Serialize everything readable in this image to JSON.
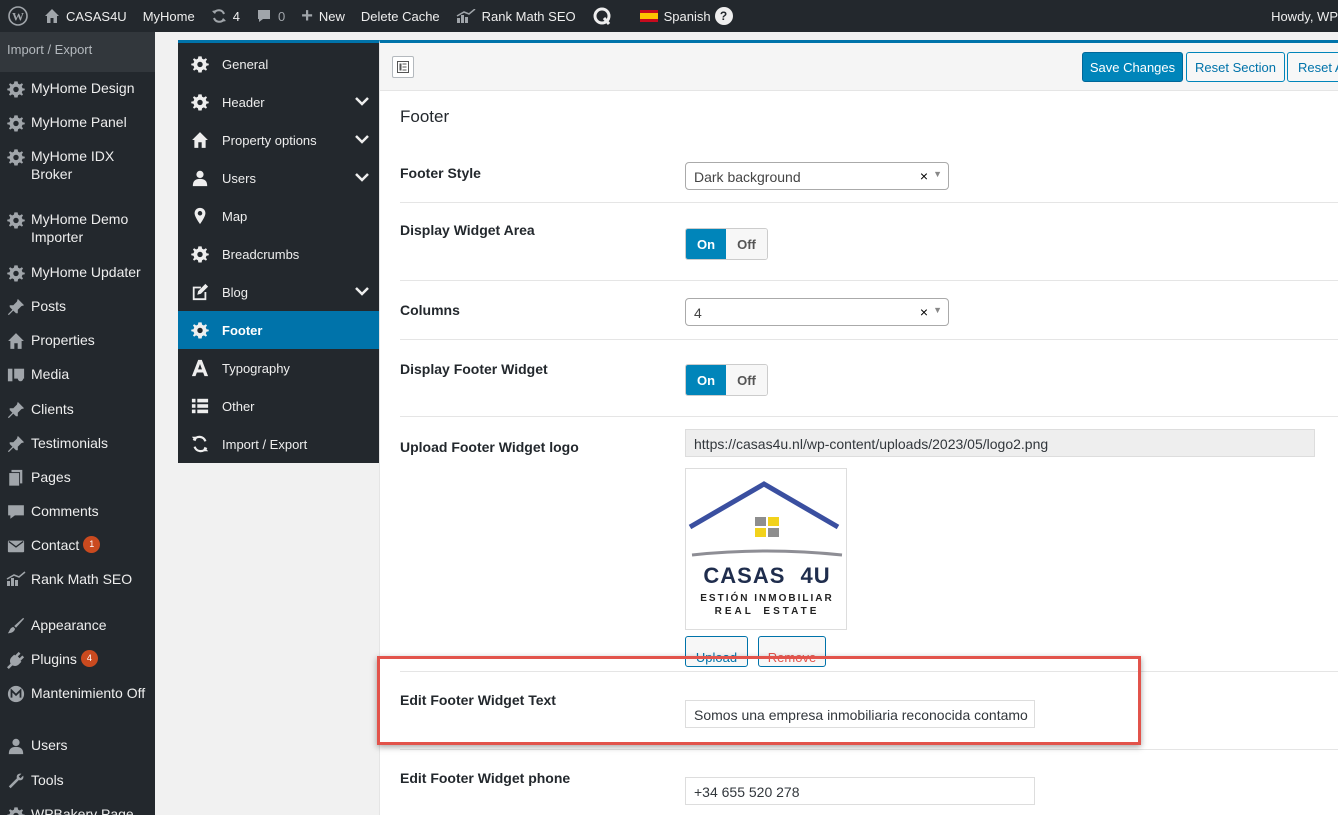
{
  "admin_bar": {
    "site_name": "CASAS4U",
    "myhome": "MyHome",
    "updates_count": "4",
    "comments_count": "0",
    "new_label": "New",
    "delete_cache": "Delete Cache",
    "rank_math": "Rank Math SEO",
    "language": "Spanish",
    "howdy": "Howdy, WP"
  },
  "admin_menu": {
    "current_submenu": "Import / Export",
    "items": [
      {
        "label": "MyHome Design",
        "icon": "gear-icon"
      },
      {
        "label": "MyHome Panel",
        "icon": "gear-icon"
      },
      {
        "label": "MyHome IDX Broker",
        "icon": "gear-icon"
      },
      {
        "label": "MyHome Demo Importer",
        "icon": "gear-icon"
      },
      {
        "label": "MyHome Updater",
        "icon": "gear-icon"
      },
      {
        "label": "Posts",
        "icon": "pin-icon"
      },
      {
        "label": "Properties",
        "icon": "home-icon"
      },
      {
        "label": "Media",
        "icon": "media-icon"
      },
      {
        "label": "Clients",
        "icon": "pin-icon"
      },
      {
        "label": "Testimonials",
        "icon": "pin-icon"
      },
      {
        "label": "Pages",
        "icon": "page-icon"
      },
      {
        "label": "Comments",
        "icon": "comment-icon"
      },
      {
        "label": "Contact",
        "icon": "mail-icon",
        "badge": "1"
      },
      {
        "label": "Rank Math SEO",
        "icon": "chart-icon"
      },
      {
        "label": "Appearance",
        "icon": "brush-icon"
      },
      {
        "label": "Plugins",
        "icon": "plug-icon",
        "badge": "4"
      },
      {
        "label": "Mantenimiento Off",
        "icon": "m-logo-icon"
      },
      {
        "label": "Users",
        "icon": "user-icon"
      },
      {
        "label": "Tools",
        "icon": "wrench-icon"
      },
      {
        "label": "WPBakery Page",
        "icon": "gear-icon"
      }
    ]
  },
  "options_nav": {
    "items": [
      {
        "label": "General",
        "icon": "gear-icon"
      },
      {
        "label": "Header",
        "icon": "gear-icon",
        "expandable": true
      },
      {
        "label": "Property options",
        "icon": "home-icon",
        "expandable": true
      },
      {
        "label": "Users",
        "icon": "user-icon",
        "expandable": true
      },
      {
        "label": "Map",
        "icon": "location-pin-icon"
      },
      {
        "label": "Breadcrumbs",
        "icon": "gear-icon"
      },
      {
        "label": "Blog",
        "icon": "edit-icon",
        "expandable": true
      },
      {
        "label": "Footer",
        "icon": "gear-icon",
        "active": true
      },
      {
        "label": "Typography",
        "icon": "typography-icon"
      },
      {
        "label": "Other",
        "icon": "list-icon"
      },
      {
        "label": "Import / Export",
        "icon": "refresh-icon"
      }
    ]
  },
  "toolbar": {
    "save_changes": "Save Changes",
    "reset_section": "Reset Section",
    "reset_all": "Reset A"
  },
  "section": {
    "title": "Footer",
    "fields": {
      "footer_style": {
        "label": "Footer Style",
        "value": "Dark background"
      },
      "display_widget_area": {
        "label": "Display Widget Area",
        "on": "On",
        "off": "Off",
        "state": "on"
      },
      "columns": {
        "label": "Columns",
        "value": "4"
      },
      "display_footer_widget": {
        "label": "Display Footer Widget",
        "on": "On",
        "off": "Off",
        "state": "on"
      },
      "upload_logo": {
        "label": "Upload Footer Widget logo",
        "url": "https://casas4u.nl/wp-content/uploads/2023/05/logo2.png",
        "upload_button": "Upload",
        "remove_button": "Remove",
        "logo_text_main": "CASAS 4U",
        "logo_text_line1": "ESTIÓN INMOBILIAR",
        "logo_text_line2": "REAL ESTATE"
      },
      "widget_text": {
        "label": "Edit Footer Widget Text",
        "value": "Somos una empresa inmobiliaria reconocida contamo"
      },
      "widget_phone": {
        "label": "Edit Footer Widget phone",
        "value": "+34 655 520 278"
      }
    }
  },
  "colors": {
    "admin_dark": "#23282d",
    "accent_blue": "#0085ba",
    "highlight_red": "#e2534b"
  }
}
